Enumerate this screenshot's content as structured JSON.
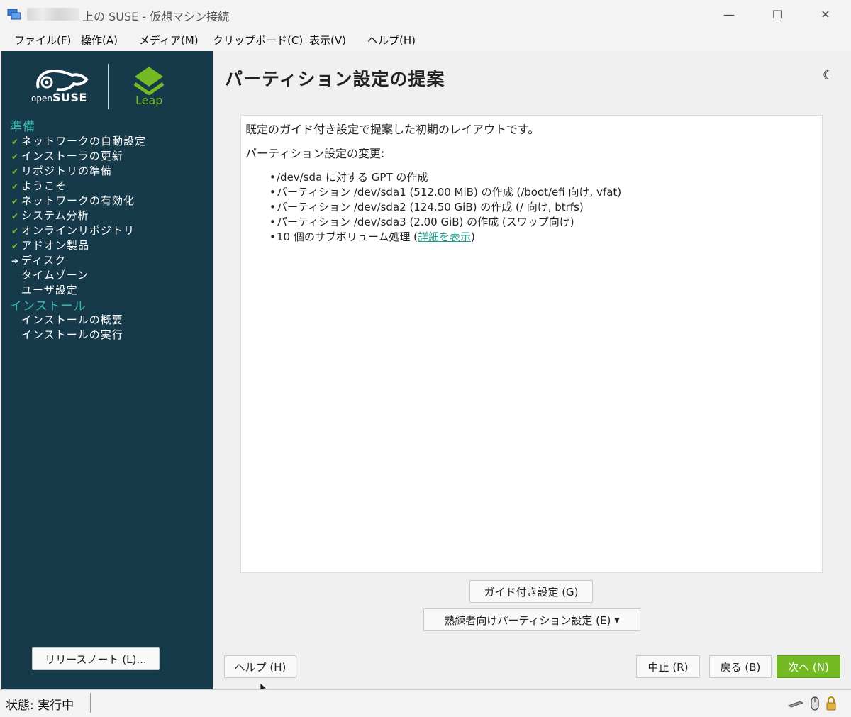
{
  "window": {
    "title": "上の SUSE - 仮想マシン接続",
    "minimize_glyph": "—",
    "maximize_glyph": "☐",
    "close_glyph": "✕"
  },
  "menu": [
    "ファイル(F)",
    "操作(A)",
    "メディア(M)",
    "クリップボード(C)",
    "表示(V)",
    "ヘルプ(H)"
  ],
  "sidebar": {
    "opensuse_small": "open",
    "opensuse_big": "SUSE",
    "leap": "Leap",
    "sections": [
      {
        "heading": "準備",
        "items": [
          {
            "label": "ネットワークの自動設定",
            "state": "done"
          },
          {
            "label": "インストーラの更新",
            "state": "done"
          },
          {
            "label": "リポジトリの準備",
            "state": "done"
          },
          {
            "label": "ようこそ",
            "state": "done"
          },
          {
            "label": "ネットワークの有効化",
            "state": "done"
          },
          {
            "label": "システム分析",
            "state": "done"
          },
          {
            "label": "オンラインリポジトリ",
            "state": "done"
          },
          {
            "label": "アドオン製品",
            "state": "done"
          },
          {
            "label": "ディスク",
            "state": "current"
          },
          {
            "label": "タイムゾーン",
            "state": "pending"
          },
          {
            "label": "ユーザ設定",
            "state": "pending"
          }
        ]
      },
      {
        "heading": "インストール",
        "items": [
          {
            "label": "インストールの概要",
            "state": "pending"
          },
          {
            "label": "インストールの実行",
            "state": "pending"
          }
        ]
      }
    ],
    "release_notes_button": "リリースノート (L)..."
  },
  "main": {
    "title": "パーティション設定の提案",
    "intro": "既定のガイド付き設定で提案した初期のレイアウトです。",
    "changes_heading": "パーティション設定の変更:",
    "changes": [
      "/dev/sda に対する GPT の作成",
      "パーティション /dev/sda1 (512.00 MiB) の作成 (/boot/efi 向け, vfat)",
      "パーティション /dev/sda2 (124.50 GiB) の作成 (/ 向け, btrfs)",
      "パーティション /dev/sda3 (2.00 GiB) の作成 (スワップ向け)"
    ],
    "subvolume_prefix": "10 個のサブボリューム処理 (",
    "subvolume_link": "詳細を表示",
    "subvolume_suffix": ")",
    "guided_button": "ガイド付き設定 (G)",
    "expert_button": "熟練者向けパーティション設定 (E)",
    "expert_arrow": "▾"
  },
  "footer": {
    "help_button": "ヘルプ (H)",
    "abort_button": "中止 (R)",
    "back_button": "戻る (B)",
    "next_button": "次へ (N)"
  },
  "status": {
    "text": "状態: 実行中"
  },
  "colors": {
    "sidebar_bg": "#173a4a",
    "accent_green": "#73ba25",
    "heading_teal": "#35b9ab",
    "link": "#1e9e8f"
  }
}
